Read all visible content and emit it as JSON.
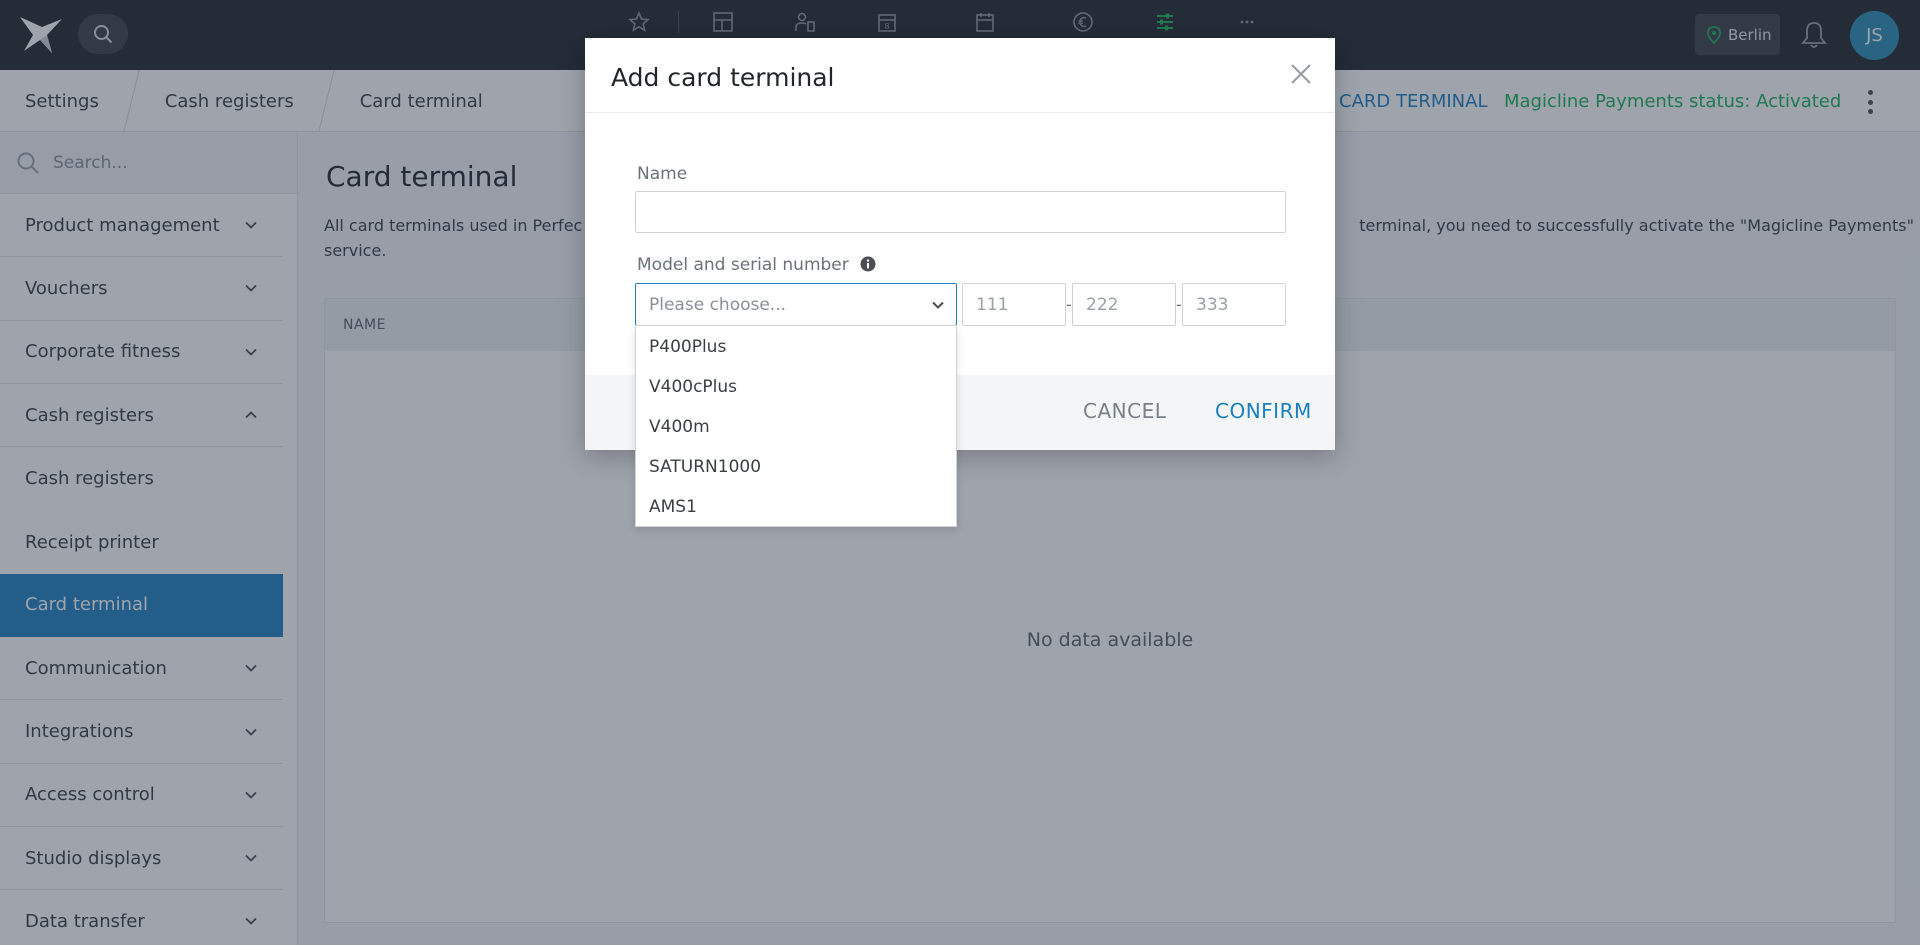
{
  "topbar": {
    "location_label": "Berlin",
    "avatar_initials": "JS",
    "nav_icons": [
      "star-icon",
      "dashboard-icon",
      "members-icon",
      "calendar-day-icon",
      "calendar-icon",
      "euro-icon",
      "sliders-icon",
      "more-icon"
    ]
  },
  "breadcrumb": {
    "items": [
      "Settings",
      "Cash registers",
      "Card terminal"
    ]
  },
  "header_actions": {
    "add_label": "CARD TERMINAL",
    "payments_status": "Magicline Payments status: Activated"
  },
  "sidebar": {
    "search_placeholder": "Search...",
    "items": [
      {
        "label": "Product management",
        "type": "group"
      },
      {
        "label": "Vouchers",
        "type": "group"
      },
      {
        "label": "Corporate fitness",
        "type": "group"
      },
      {
        "label": "Cash registers",
        "type": "group-open"
      },
      {
        "label": "Cash registers",
        "type": "sub"
      },
      {
        "label": "Receipt printer",
        "type": "sub"
      },
      {
        "label": "Card terminal",
        "type": "active"
      },
      {
        "label": "Communication",
        "type": "group"
      },
      {
        "label": "Integrations",
        "type": "group"
      },
      {
        "label": "Access control",
        "type": "group"
      },
      {
        "label": "Studio displays",
        "type": "group"
      },
      {
        "label": "Data transfer",
        "type": "group"
      }
    ]
  },
  "main": {
    "title": "Card terminal",
    "description": "All card terminals used in Perfec... terminal, you need to successfully activate the \"Magicline Payments\" service.",
    "description_left": "All card terminals used in Perfec",
    "description_right": "terminal, you need to successfully activate the \"Magicline Payments\"",
    "description_line2": "service.",
    "table_header": "NAME",
    "empty_text": "No data available"
  },
  "modal": {
    "title": "Add card terminal",
    "name_label": "Name",
    "name_value": "",
    "model_label": "Model and serial number",
    "select_placeholder": "Please choose...",
    "serial_placeholders": [
      "111",
      "222",
      "333"
    ],
    "cancel_label": "CANCEL",
    "confirm_label": "CONFIRM"
  },
  "dropdown": {
    "options": [
      "P400Plus",
      "V400cPlus",
      "V400m",
      "SATURN1000",
      "AMS1"
    ]
  },
  "colors": {
    "accent": "#1f80c0",
    "status_green": "#1bb356",
    "topbar": "#22272d",
    "active_nav_icon": "#1bb356"
  }
}
